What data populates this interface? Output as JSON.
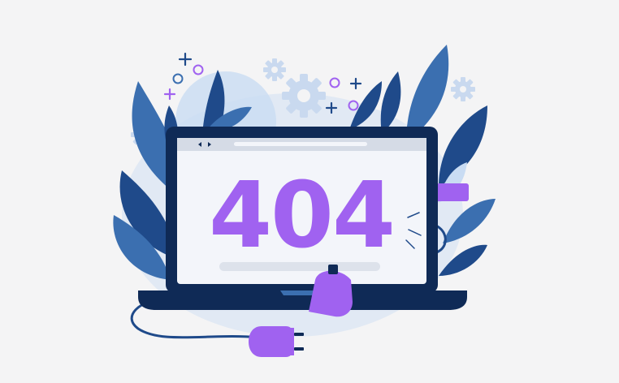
{
  "error": {
    "code": "404"
  },
  "colors": {
    "background": "#f4f4f5",
    "laptop_frame": "#0f2a56",
    "leaf_dark": "#1f4a8a",
    "leaf_mid": "#3b6fb0",
    "leaf_light": "#c9dcf3",
    "accent_purple": "#a062f0",
    "gear": "#c9d9ef",
    "screen": "#f3f5fa",
    "browser_bar": "#d5dbe6"
  },
  "icons": {
    "gears": "gear-icon",
    "sparkles": "plus-sparkle-icon",
    "rings": "ring-icon",
    "plugs": "power-plug-icon"
  }
}
